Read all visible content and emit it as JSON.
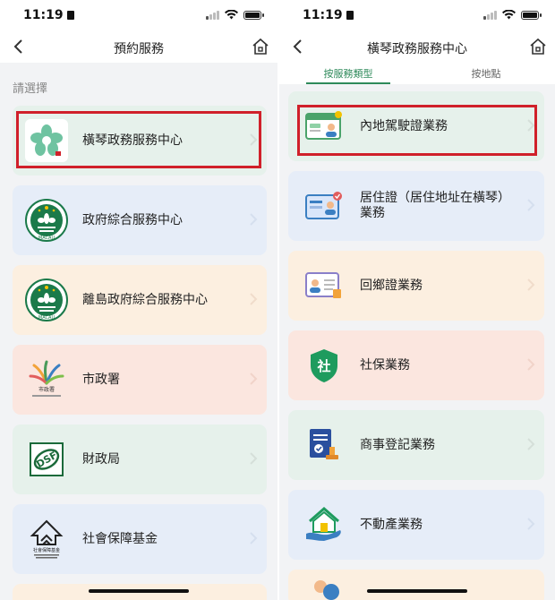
{
  "colors": {
    "accent": "#2f8a5b",
    "highlight": "#d0202a"
  },
  "left": {
    "status": {
      "time": "11:19"
    },
    "nav": {
      "title": "預約服務"
    },
    "hint": "請選擇",
    "items": [
      {
        "label": "橫琴政務服務中心",
        "icon": "hengqin-logo-icon"
      },
      {
        "label": "政府綜合服務中心",
        "icon": "macau-emblem-icon"
      },
      {
        "label": "離島政府綜合服務中心",
        "icon": "macau-emblem-icon"
      },
      {
        "label": "市政署",
        "icon": "iam-logo-icon",
        "sub": "市政署"
      },
      {
        "label": "財政局",
        "icon": "dsf-logo-icon",
        "sub": "DSF"
      },
      {
        "label": "社會保障基金",
        "icon": "fss-logo-icon",
        "sub": "社會保障基金"
      }
    ],
    "emblem_text": "MACAU"
  },
  "right": {
    "status": {
      "time": "11:19"
    },
    "nav": {
      "title": "橫琴政務服務中心"
    },
    "tabs": [
      "按服務類型",
      "按地點"
    ],
    "items": [
      {
        "label": "內地駕駛證業務",
        "icon": "driving-license-icon"
      },
      {
        "label": "居住證（居住地址在橫琴）業務",
        "icon": "residence-permit-icon"
      },
      {
        "label": "回鄉證業務",
        "icon": "home-return-permit-icon"
      },
      {
        "label": "社保業務",
        "icon": "social-security-shield-icon",
        "glyph": "社"
      },
      {
        "label": "商事登記業務",
        "icon": "business-registration-icon"
      },
      {
        "label": "不動產業務",
        "icon": "real-estate-icon"
      }
    ]
  }
}
